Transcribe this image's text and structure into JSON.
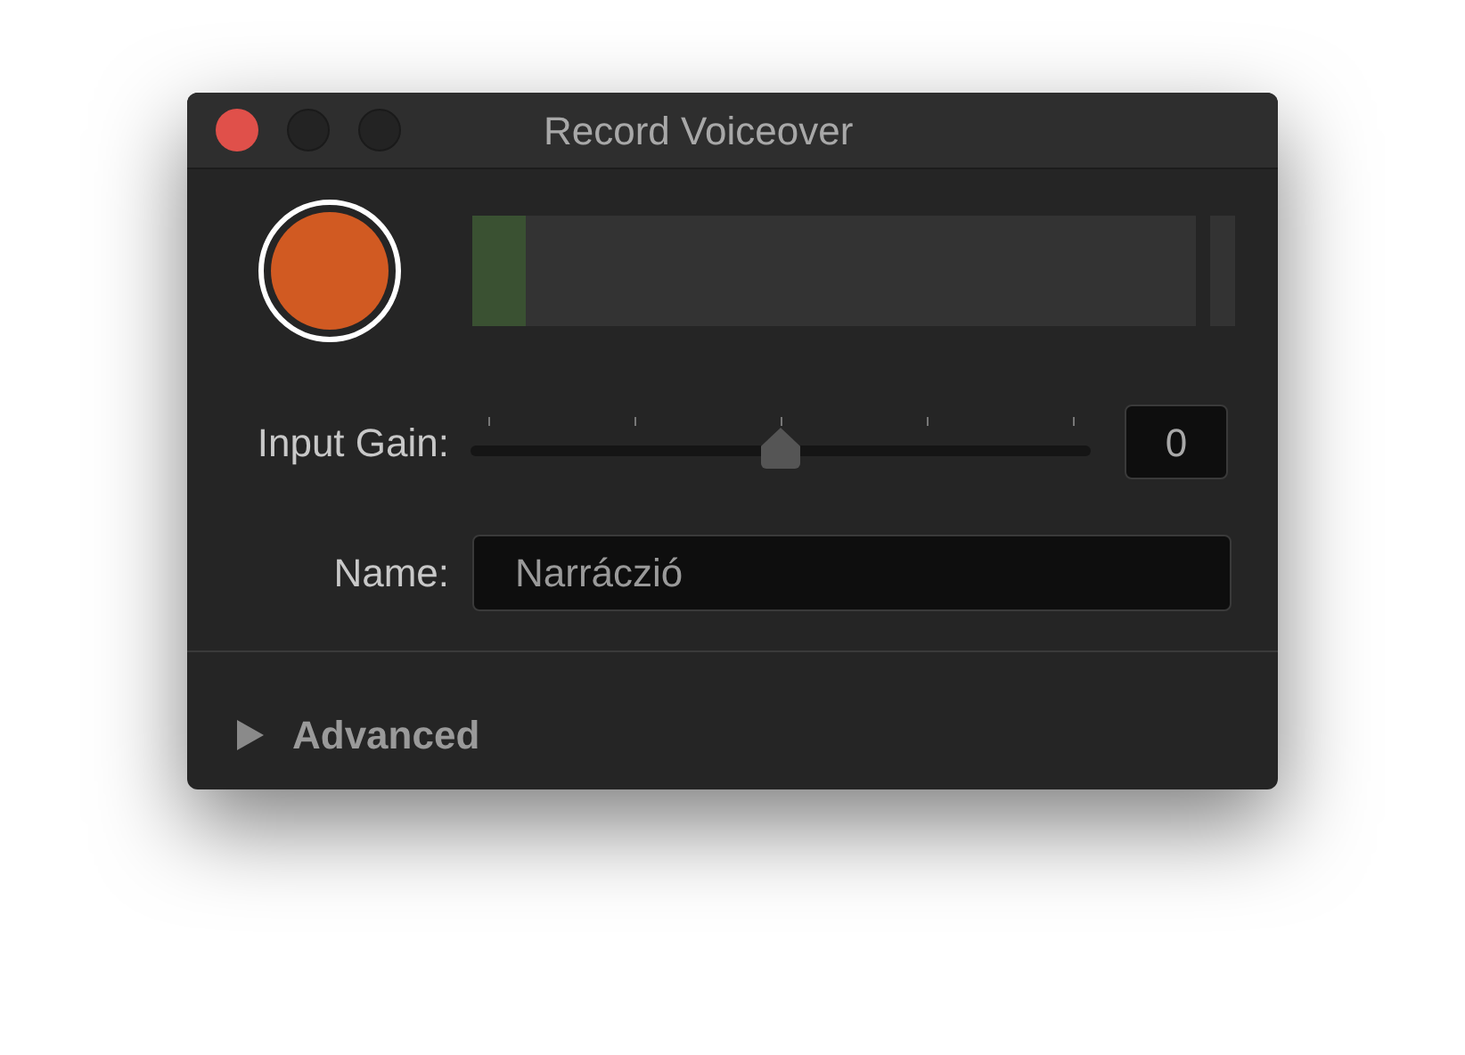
{
  "window": {
    "title": "Record Voiceover"
  },
  "meter": {
    "level": 0.075
  },
  "gain": {
    "label": "Input Gain:",
    "level": 0.5,
    "value": "0"
  },
  "name": {
    "label": "Name:",
    "value": "Narráczió"
  },
  "advanced": {
    "label": "Advanced",
    "expanded": false
  }
}
